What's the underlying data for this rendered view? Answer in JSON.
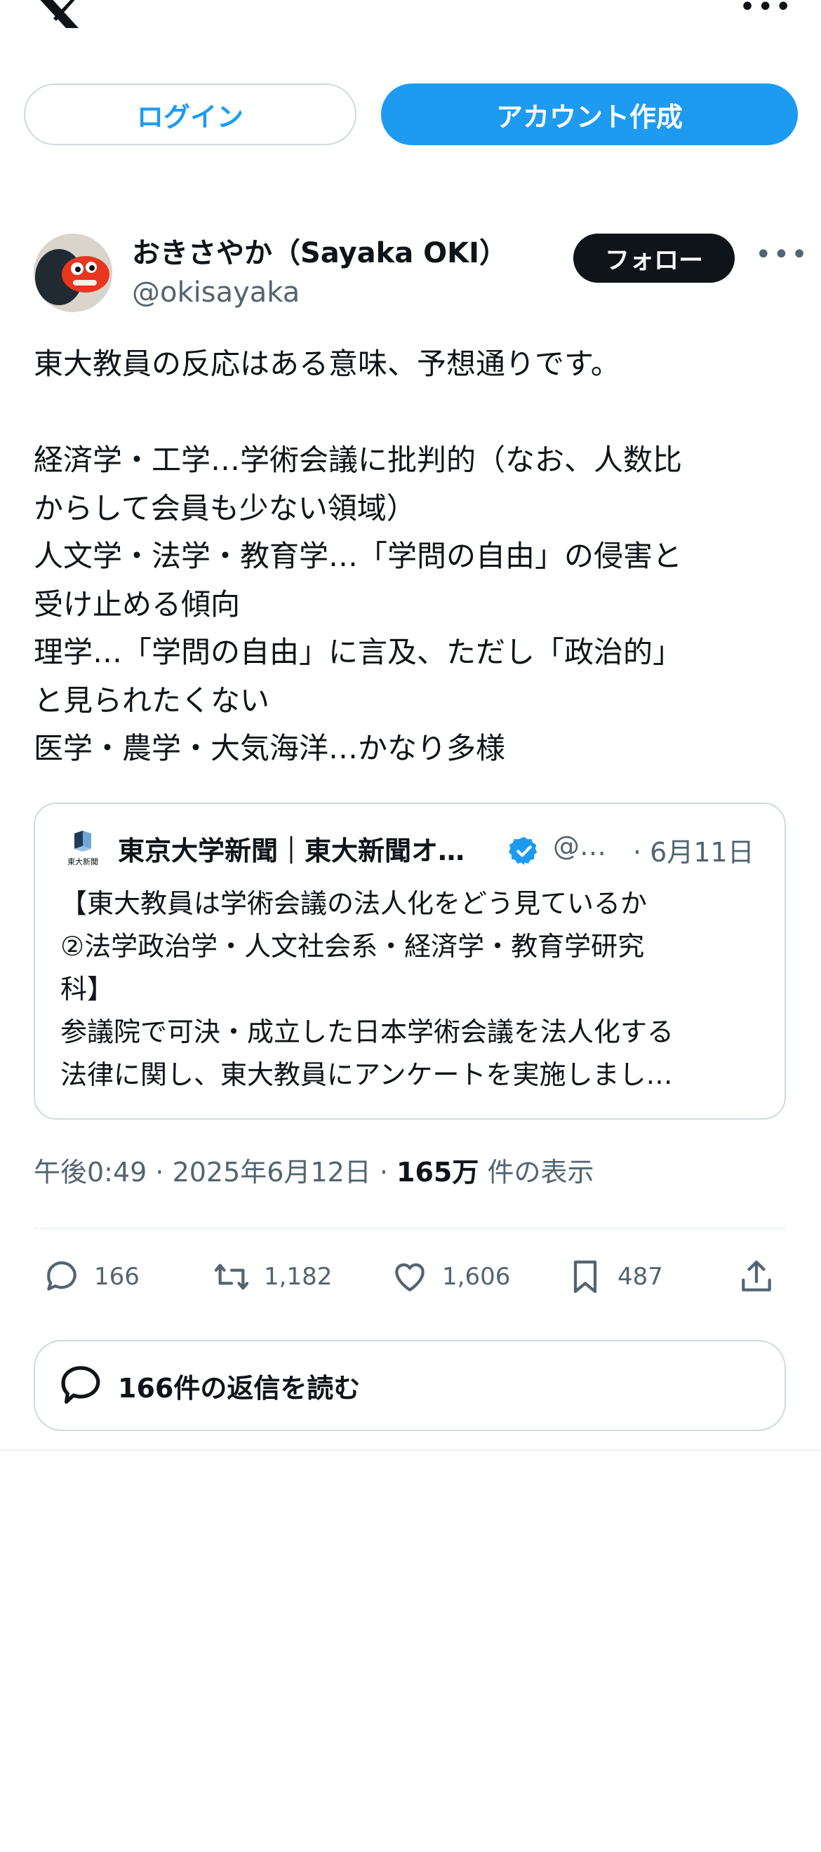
{
  "header": {
    "logo_icon": "x-logo-icon",
    "more_label": "•••",
    "login_label": "ログイン",
    "create_account_label": "アカウント作成"
  },
  "post": {
    "author_name": "おきさやか（Sayaka OKI）",
    "author_handle": "@okisayaka",
    "follow_label": "フォロー",
    "more_label": "•••",
    "text_lines": [
      "東大教員の反応はある意味、予想通りです。",
      "",
      " 経済学・工学…学術会議に批判的（なお、人数比",
      "からして会員も少ない領域）",
      "人文学・法学・教育学…「学問の自由」の侵害と",
      "受け止める傾向",
      "理学…「学問の自由」に言及、ただし「政治的」",
      "と見られたくない",
      "医学・農学・大気海洋…かなり多様"
    ],
    "quote": {
      "name": "東京大学新聞｜東大新聞オ…",
      "handle": "@…",
      "date": "· 6月11日",
      "logo_caption": "東大新聞",
      "text_lines": [
        "【東大教員は学術会議の法人化をどう見ているか",
        "②法学政治学・人文社会系・経済学・教育学研究",
        "科】",
        "参議院で可決・成立した日本学術会議を法人化する",
        "法律に関し、東大教員にアンケートを実施しまし…"
      ]
    },
    "meta": {
      "time": "午後0:49 · 2025年6月12日 · ",
      "views": "165万",
      "views_label": " 件の表示"
    },
    "actions": {
      "replies": "166",
      "reposts": "1,182",
      "likes": "1,606",
      "bookmarks": "487"
    },
    "read_replies_label": "166件の返信を読む"
  },
  "colors": {
    "accent": "#1d9bf0",
    "text": "#0f1419",
    "muted": "#536471",
    "border": "#cfd9de"
  }
}
